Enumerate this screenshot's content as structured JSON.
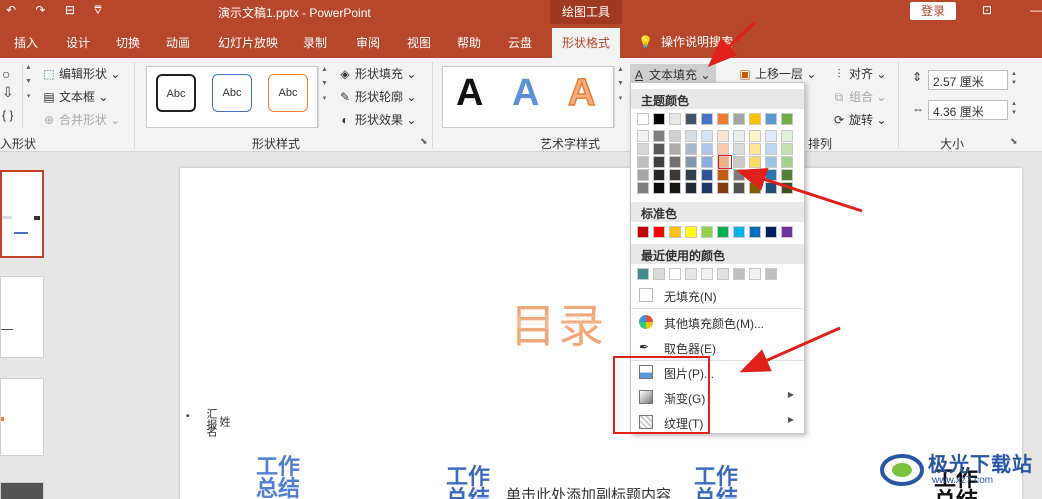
{
  "titlebar": {
    "quick_access": [
      "↶",
      "↷",
      "⊟",
      "⩢"
    ],
    "doc_title": "演示文稿1.pptx  -  PowerPoint",
    "context_tools": "绘图工具",
    "login": "登录",
    "window_btn": "⊡",
    "minimize": "—"
  },
  "tabs": [
    "插入",
    "设计",
    "切换",
    "动画",
    "幻灯片放映",
    "录制",
    "审阅",
    "视图",
    "帮助",
    "云盘",
    "形状格式"
  ],
  "tab_search": "操作说明搜索",
  "ribbon": {
    "insert_shapes": {
      "edit_shape": "编辑形状",
      "textbox": "文本框",
      "merge_shapes": "合并形状",
      "label": "入形状"
    },
    "shape_styles": {
      "samples": [
        "Abc",
        "Abc",
        "Abc"
      ],
      "shape_fill": "形状填充",
      "shape_outline": "形状轮廓",
      "shape_effects": "形状效果",
      "label": "形状样式"
    },
    "wordart": {
      "samples": [
        "A",
        "A",
        "A"
      ],
      "text_fill": "文本填充",
      "label": "艺术字样式"
    },
    "arrange": {
      "bring_forward": "上移一层",
      "align": "对齐",
      "group": "组合",
      "rotate": "旋转",
      "label": "排列"
    },
    "size": {
      "height": "2.57 厘米",
      "width": "4.36 厘米",
      "label": "大小"
    }
  },
  "slide": {
    "title": "目录",
    "vtext1": "汇报",
    "vtext2": "名",
    "vtext3": "姓",
    "wordart_items": [
      "工作总结",
      "工作总结",
      "工作总结",
      "工作总结"
    ],
    "subtitle": "单击此处添加副标题内容"
  },
  "dropdown": {
    "theme_colors_label": "主题颜色",
    "standard_colors_label": "标准色",
    "recent_colors_label": "最近使用的颜色",
    "no_fill": "无填充(N)",
    "more_colors": "其他填充颜色(M)...",
    "eyedropper": "取色器(E)",
    "picture": "图片(P)...",
    "gradient": "渐变(G)",
    "texture": "纹理(T)",
    "theme_top_row": [
      "#ffffff",
      "#000000",
      "#e7e6e6",
      "#44546a",
      "#4472c4",
      "#ed7d31",
      "#a5a5a5",
      "#ffc000",
      "#5b9bd5",
      "#70ad47"
    ],
    "theme_shades": [
      [
        "#f2f2f2",
        "#7f7f7f",
        "#d0cece",
        "#d6dce4",
        "#d9e2f3",
        "#fbe5d5",
        "#ededed",
        "#fff2cc",
        "#deebf6",
        "#e2efd9"
      ],
      [
        "#d8d8d8",
        "#595959",
        "#aeabab",
        "#adb9ca",
        "#b4c6e7",
        "#f7cbac",
        "#dbdbdb",
        "#fee599",
        "#bdd7ee",
        "#c5e0b3"
      ],
      [
        "#bfbfbf",
        "#3f3f3f",
        "#757070",
        "#8496b0",
        "#8eaadb",
        "#f4b183",
        "#c9c9c9",
        "#ffd965",
        "#9cc3e5",
        "#a8d08d"
      ],
      [
        "#a5a5a5",
        "#262626",
        "#3a3838",
        "#323f4f",
        "#2f5496",
        "#c55a11",
        "#7b7b7b",
        "#bf9000",
        "#2e75b5",
        "#538135"
      ],
      [
        "#7f7f7f",
        "#0c0c0c",
        "#171616",
        "#222a35",
        "#1e3764",
        "#833c0b",
        "#525252",
        "#7f6000",
        "#1e4e79",
        "#375623"
      ]
    ],
    "standard": [
      "#c00000",
      "#ff0000",
      "#ffc000",
      "#ffff00",
      "#92d050",
      "#00b050",
      "#00b0f0",
      "#0070c0",
      "#002060",
      "#7030a0"
    ],
    "recent": [
      "#3e8e8e",
      "#d9d9d9",
      "#ffffff",
      "#e7e6e6",
      "#f2f2f2",
      "#e0e0e0",
      "#bfbfbf",
      "#f2f2f2",
      "#bfbfbf"
    ]
  },
  "watermark": {
    "text": "极光下载站",
    "url": "www.xz7.com"
  },
  "colors": {
    "brand": "#b7472a",
    "highlight_box": "#e0201a",
    "title_orange": "#f0a87b",
    "wordart_blue": "#4472c4"
  }
}
